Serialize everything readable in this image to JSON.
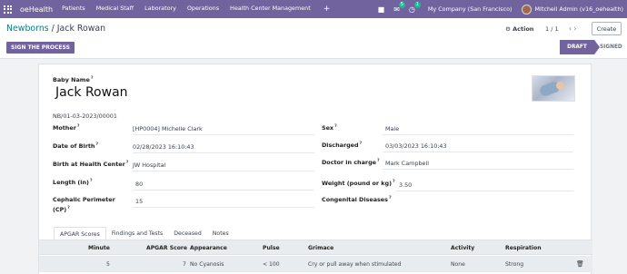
{
  "navbar": {
    "brand": "oeHealth",
    "menu": [
      "Patients",
      "Medical Staff",
      "Laboratory",
      "Operations",
      "Health Center Management"
    ],
    "plus": "+",
    "messages_count": "5",
    "activities_count": "1",
    "company": "My Company (San Francisco)",
    "user": "Mitchell Admin (v16_oehealth)"
  },
  "control": {
    "breadcrumb_parent": "Newborns",
    "breadcrumb_sep": "/",
    "breadcrumb_current": "Jack Rowan",
    "action_label": "Action",
    "pager": "1 / 1",
    "create_label": "Create",
    "sign_label": "SIGN THE PROCESS",
    "status_draft": "DRAFT",
    "status_signed": "SIGNED"
  },
  "form": {
    "baby_name_label": "Baby Name",
    "baby_name": "Jack Rowan",
    "reference": "NB/01-03-2023/00001",
    "help_mark": "?",
    "left": [
      {
        "label": "Mother",
        "value": "[HP0004] Michelle Clark"
      },
      {
        "label": "Date of Birth",
        "value": "02/28/2023 16:10:43"
      },
      {
        "label": "Birth at Health Center",
        "value": "JW Hospital"
      },
      {
        "label": "Length (in)",
        "value": "80"
      },
      {
        "label": "Cephalic Perimeter",
        "label2": "(CP)",
        "value": "15"
      }
    ],
    "right": [
      {
        "label": "Sex",
        "value": "Male"
      },
      {
        "label": "Discharged",
        "value": "03/03/2023 16:10:43"
      },
      {
        "label": "Doctor in charge",
        "value": "Mark Campbell"
      },
      {
        "label": "Weight (pound or kg)",
        "value": "3.50"
      },
      {
        "label": "Congenital Diseases",
        "value": ""
      }
    ]
  },
  "tabs": [
    "APGAR Scores",
    "Findings and Tests",
    "Deceased",
    "Notes"
  ],
  "apgar_table": {
    "headers": [
      "Minute",
      "APGAR Score",
      "Appearance",
      "Pulse",
      "Grimace",
      "Activity",
      "Respiration"
    ],
    "rows": [
      [
        "5",
        "7",
        "No Cyanosis",
        "< 100",
        "Cry or pull away when stimulated",
        "None",
        "Strong"
      ]
    ]
  }
}
